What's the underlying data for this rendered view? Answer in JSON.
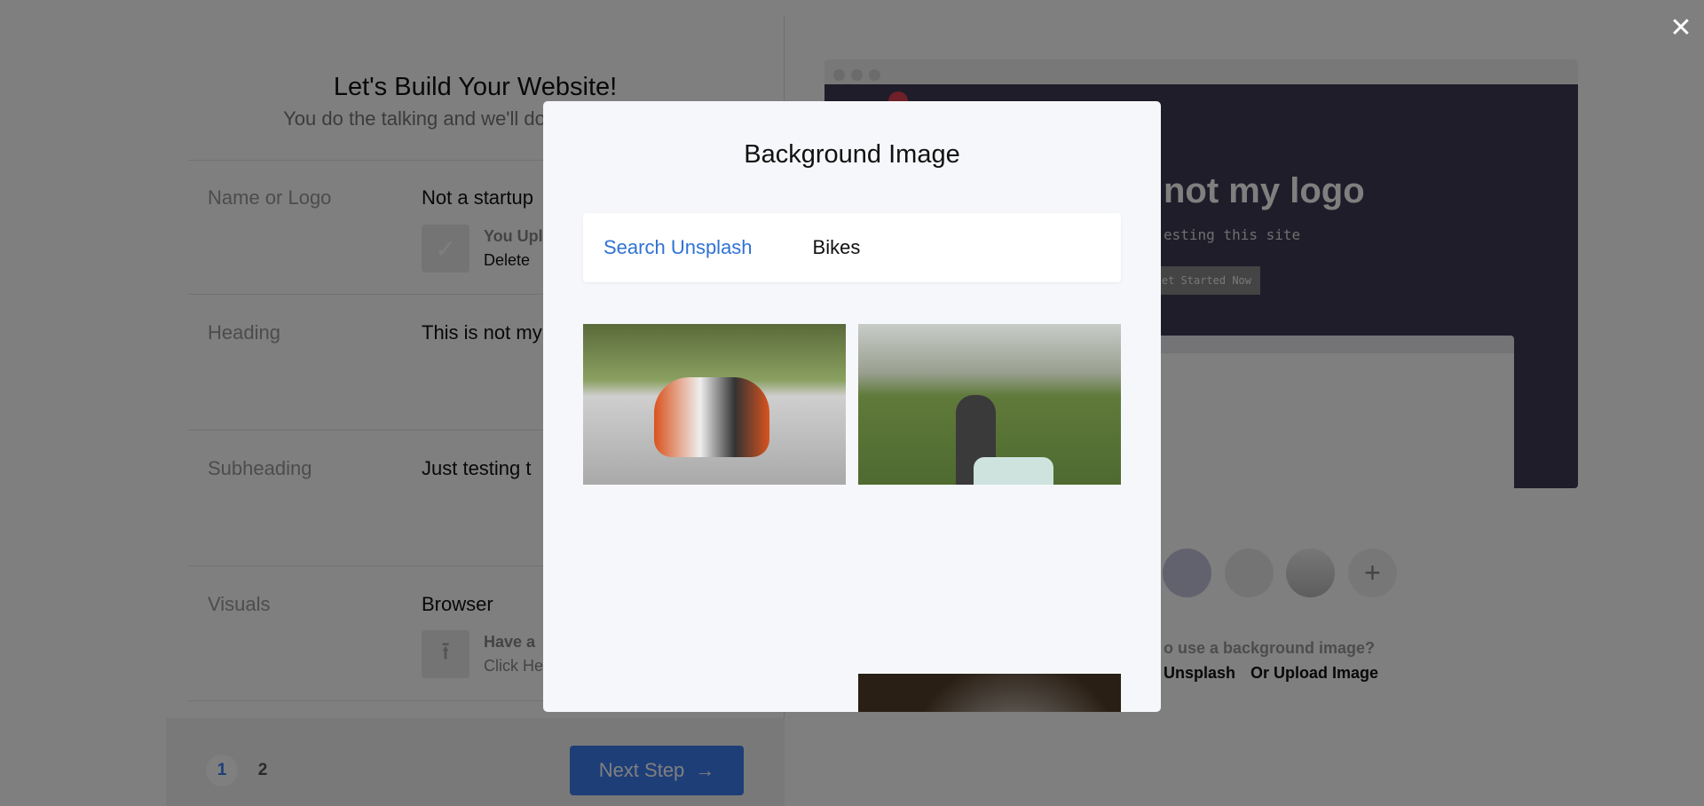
{
  "builder": {
    "title": "Let's Build Your Website!",
    "subtitle": "You do the talking and we'll do the designing",
    "rows": [
      {
        "label": "Name or Logo",
        "value": "Not a startup",
        "note1": "You Upl",
        "note2": "Delete"
      },
      {
        "label": "Heading",
        "value": "This is not my"
      },
      {
        "label": "Subheading",
        "value": "Just testing t"
      },
      {
        "label": "Visuals",
        "value": "Browser",
        "note1": "Have a",
        "note2": "Click He"
      }
    ],
    "pages": [
      "1",
      "2"
    ],
    "next_label": "Next Step"
  },
  "preview": {
    "heading": "not my logo",
    "subheading": "esting this site",
    "button": "et Started Now",
    "bg_question": "o use a background image?",
    "link_unsplash": "Unsplash",
    "link_upload": "Or Upload Image",
    "plus": "+"
  },
  "modal": {
    "title": "Background Image",
    "tab": "Search Unsplash",
    "query": "Bikes"
  },
  "colors": {
    "accent": "#2f72d4",
    "button": "#3d7cf0",
    "preview_bg": "#403a55"
  },
  "icons": {
    "close": "close-icon",
    "check": "check-icon",
    "upload": "upload-icon",
    "arrow": "arrow-right-icon"
  }
}
